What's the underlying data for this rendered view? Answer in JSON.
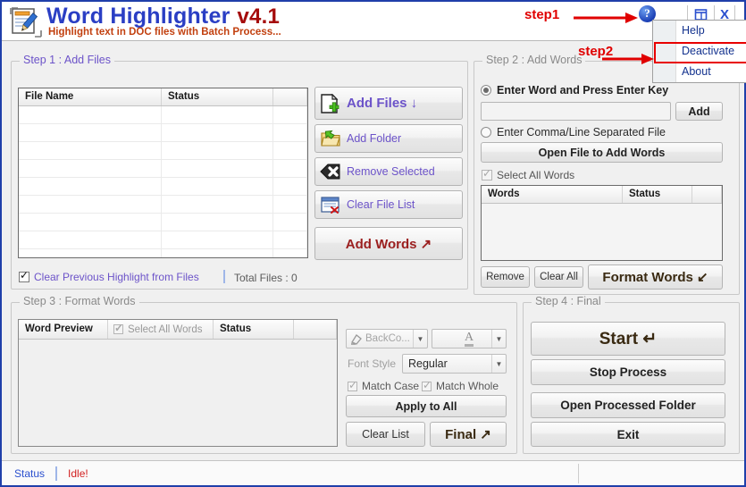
{
  "header": {
    "title": "Word Highlighter",
    "version": "v4.1",
    "subtitle": "Highlight text in DOC files with Batch Process...",
    "app_icon": "document-pencil-icon",
    "help_icon": "?",
    "window_restore_icon": "restore-window-icon",
    "window_close_icon": "X",
    "accent_blue": "#2a3ec4",
    "accent_red": "#a50b0b"
  },
  "annotations": [
    {
      "label": "step1",
      "color": "#e00000"
    },
    {
      "label": "step2",
      "color": "#e00000"
    }
  ],
  "menu": {
    "items": [
      {
        "label": "Help",
        "highlighted": false
      },
      {
        "label": "Deactivate",
        "highlighted": true
      },
      {
        "label": "About",
        "highlighted": false
      }
    ],
    "highlight_color": "#e80000",
    "text_color": "#13328e"
  },
  "step1": {
    "legend": "Step 1 : Add Files",
    "table": {
      "columns": [
        "File Name",
        "Status",
        ""
      ],
      "rows": []
    },
    "buttons": [
      {
        "label": "Add Files ↓",
        "icon": "add-file-icon",
        "style": "purple-big"
      },
      {
        "label": "Add Folder",
        "icon": "add-folder-icon",
        "style": "purple"
      },
      {
        "label": "Remove Selected",
        "icon": "remove-icon",
        "style": "purple"
      },
      {
        "label": "Clear File List",
        "icon": "clear-list-icon",
        "style": "purple"
      },
      {
        "label": "Add Words ↗",
        "icon": "",
        "style": "red-big"
      }
    ],
    "clear_previous": {
      "label": "Clear Previous Highlight from Files",
      "checked": true
    },
    "total_files": "Total Files : 0"
  },
  "step2": {
    "legend": "Step 2 : Add Words",
    "radio_word": {
      "label": "Enter Word and Press Enter Key",
      "selected": true
    },
    "word_input": {
      "value": "",
      "placeholder": ""
    },
    "add_button": "Add",
    "radio_file": {
      "label": "Enter Comma/Line Separated File",
      "selected": false
    },
    "open_file_button": "Open File to Add Words",
    "select_all_words": {
      "label": "Select All Words",
      "checked": true
    },
    "table": {
      "columns": [
        "Words",
        "Status",
        ""
      ],
      "rows": []
    },
    "remove_button": "Remove",
    "clear_all_button": "Clear All",
    "format_words_button": "Format Words ↙"
  },
  "step3": {
    "legend": "Step 3 : Format Words",
    "table": {
      "columns": [
        "Word Preview",
        "Status",
        ""
      ],
      "select_all_words": {
        "label": "Select All Words",
        "checked": true
      },
      "rows": []
    },
    "back_color": {
      "label": "BackCo...",
      "icon": "highlighter-icon"
    },
    "font_color": {
      "label": "A",
      "icon": "font-color-icon"
    },
    "font_style_label": "Font Style",
    "font_style_value": "Regular",
    "match_case": {
      "label": "Match Case",
      "checked": true
    },
    "match_whole": {
      "label": "Match Whole",
      "checked": true
    },
    "apply_to_all_button": "Apply to All",
    "clear_list_button": "Clear List",
    "final_button": "Final ↗"
  },
  "step4": {
    "legend": "Step 4 : Final",
    "buttons": [
      {
        "label": "Start ↵",
        "size": "big"
      },
      {
        "label": "Stop Process",
        "size": "normal"
      },
      {
        "label": "Open Processed Folder",
        "size": "normal"
      },
      {
        "label": "Exit",
        "size": "normal"
      }
    ]
  },
  "statusbar": {
    "label": "Status",
    "value": "Idle!",
    "label_color": "#2a4fce",
    "value_color": "#d22020"
  }
}
